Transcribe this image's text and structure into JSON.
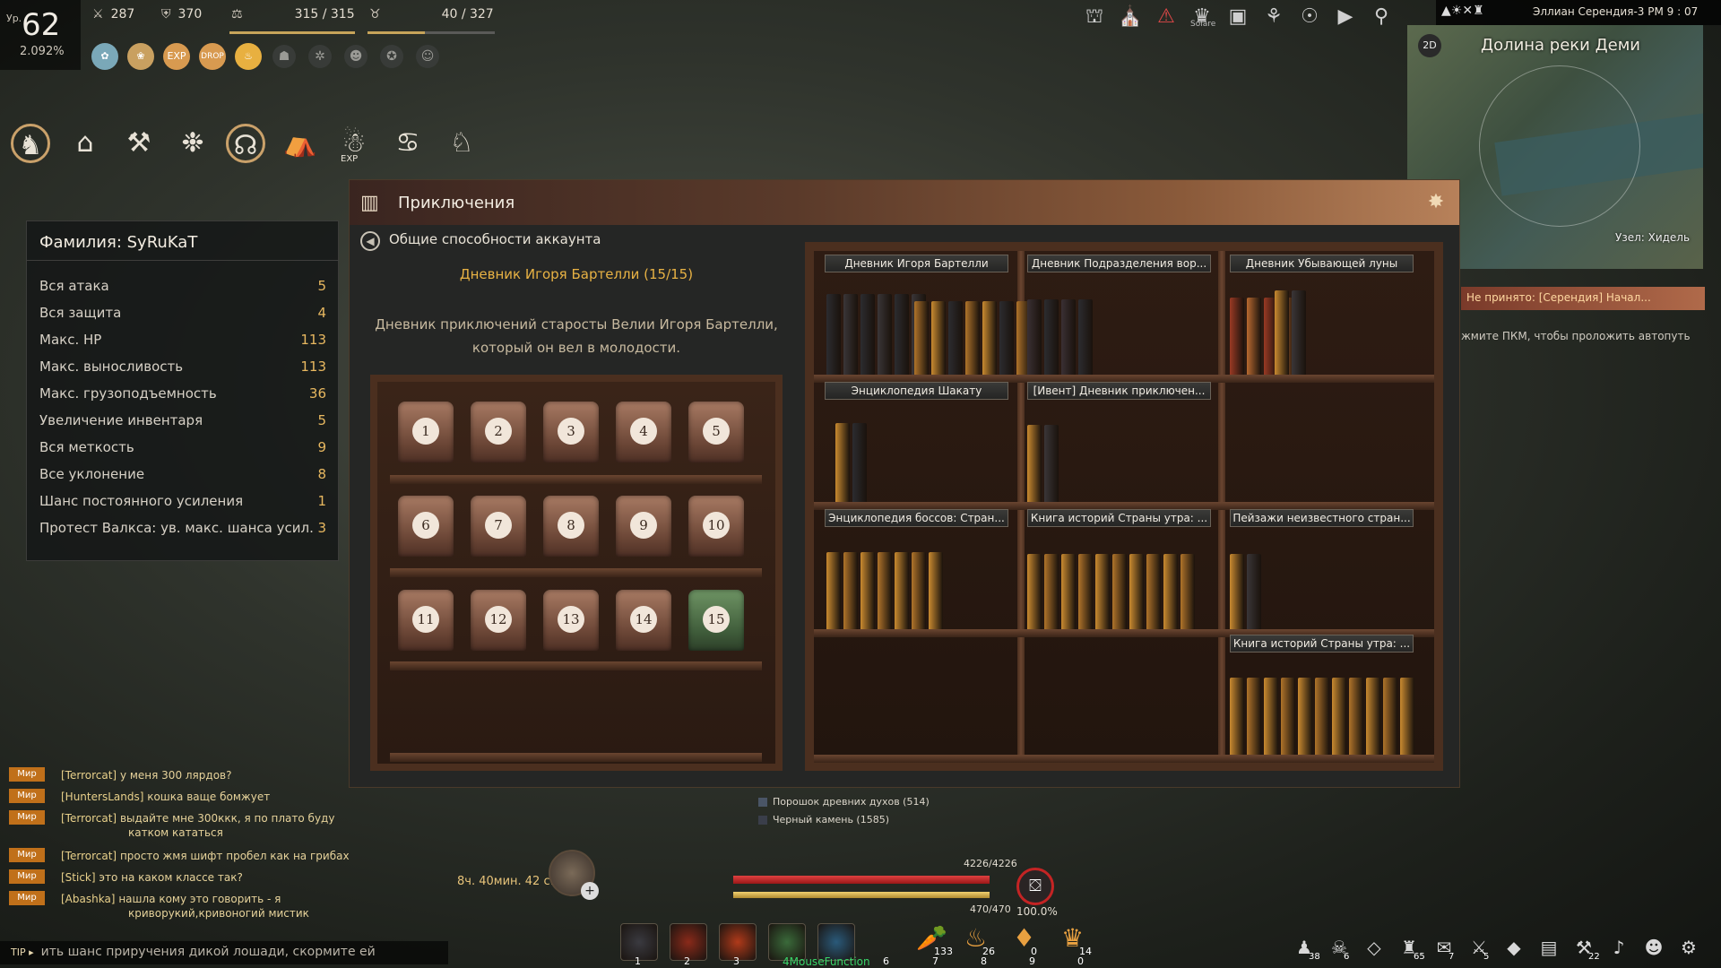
{
  "hud": {
    "level_prefix": "Ур.",
    "level": "62",
    "level_pct": "2.092%",
    "attack": "287",
    "defense": "370",
    "weight": "315 / 315",
    "inventory": "40 / 327",
    "exp_label": "EXP",
    "buff_exp": "EXP",
    "buff_drop": "DROP"
  },
  "top_right": {
    "server": "Эллиан Серендия-3  PM 9 : 07",
    "solare": "Solare"
  },
  "minimap": {
    "mode": "2D",
    "title": "Долина реки Деми",
    "node": "Узел: Хидель"
  },
  "quest": {
    "title": "Не принято: [Серендия] Начал...",
    "hint": "жмите ПКМ, чтобы проложить автопуть"
  },
  "family": {
    "title": "Фамилия: SyRuKaT",
    "rows": [
      {
        "label": "Вся атака",
        "value": "5"
      },
      {
        "label": "Вся защита",
        "value": "4"
      },
      {
        "label": "Макс. HP",
        "value": "113"
      },
      {
        "label": "Макс. выносливость",
        "value": "113"
      },
      {
        "label": "Макс. грузоподъемность",
        "value": "36"
      },
      {
        "label": "Увеличение инвентаря",
        "value": "5"
      },
      {
        "label": "Вся меткость",
        "value": "9"
      },
      {
        "label": "Все уклонение",
        "value": "8"
      },
      {
        "label": "Шанс постоянного усиления",
        "value": "1"
      },
      {
        "label": "Протест Валкса: ув. макс. шанса усил.",
        "value": "3"
      }
    ]
  },
  "window": {
    "title": "Приключения",
    "back_label": "Общие способности аккаунта",
    "diary_title": "Дневник Игоря Бартелли (15/15)",
    "diary_desc_1": "Дневник приключений старосты Велии Игоря Бартелли,",
    "diary_desc_2": "который он вел в молодости.",
    "volumes": [
      "1",
      "2",
      "3",
      "4",
      "5",
      "6",
      "7",
      "8",
      "9",
      "10",
      "11",
      "12",
      "13",
      "14",
      "15"
    ],
    "books": [
      "Дневник Игоря Бартелли",
      "Дневник Подразделения вор...",
      "Дневник Убывающей луны",
      "Энциклопедия Шакату",
      "[Ивент] Дневник приключен...",
      "Энциклопедия боссов: Стран...",
      "Книга историй Страны утра: ...",
      "Пейзажи неизвестного стран...",
      "Книга историй Страны утра: ..."
    ]
  },
  "loot": [
    {
      "text": "Порошок древних духов (514)"
    },
    {
      "text": "Черный камень (1585)"
    }
  ],
  "vitals": {
    "hp": "4226/4226",
    "sp": "470/470",
    "energy_pct": "100.0%",
    "timer": "8ч. 40мин. 42 с."
  },
  "skills": {
    "nums": [
      "1",
      "2",
      "3",
      "4",
      "6",
      "7",
      "8",
      "9",
      "0"
    ],
    "counts": [
      "133",
      "26",
      "0",
      "14"
    ],
    "macro": "4MouseFunction"
  },
  "chat": [
    {
      "tag": "Мир",
      "name": "[Terrorcat]",
      "text": "у меня 300 лярдов?"
    },
    {
      "tag": "Мир",
      "name": "[HuntersLands]",
      "text": "кошка ваще бомжует"
    },
    {
      "tag": "Мир",
      "name": "[Terrorcat]",
      "text": "выдайте мне 300ккк, я по плато буду",
      "cont": "катком кататься"
    },
    {
      "tag": "Мир",
      "name": "[Terrorcat]",
      "text": "просто жмя шифт пробел как на грибах"
    },
    {
      "tag": "Мир",
      "name": "[Stick]",
      "text": "это на каком классе так?"
    },
    {
      "tag": "Мир",
      "name": "[Abashka]",
      "text": "нашла кому это говорить - я",
      "cont": "криворукий,кривоногий мистик"
    }
  ],
  "tip": {
    "tag": "TIP ▸",
    "text": "ить шанс приручения дикой лошади, скормите ей"
  },
  "sys_badges": [
    "38",
    "6",
    "65",
    "7",
    "5",
    "22"
  ]
}
